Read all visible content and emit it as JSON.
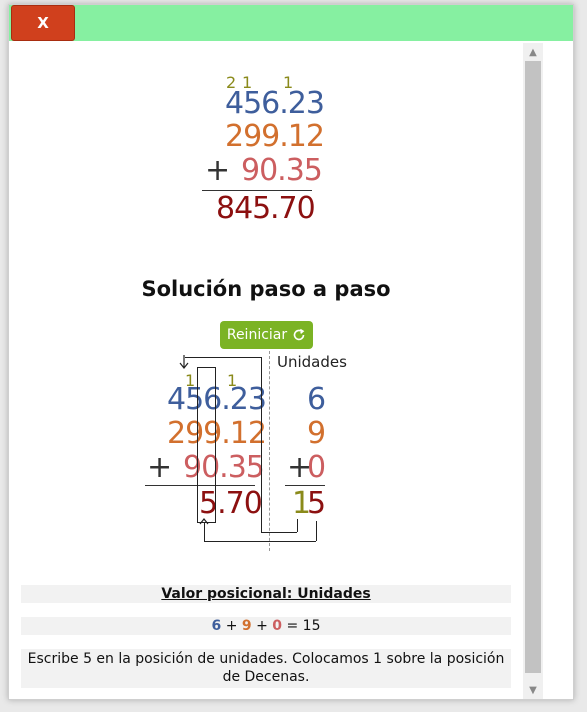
{
  "window": {
    "close_label": "X"
  },
  "top_problem": {
    "carries": [
      "2",
      "1",
      "1"
    ],
    "addends": [
      "456.23",
      "299.12",
      "90.35"
    ],
    "operator": "+",
    "result_int": "845",
    "result_dec": ".70"
  },
  "solution": {
    "heading": "Solución paso a paso",
    "reset_label": "Reiniciar",
    "reset_icon": "refresh-icon",
    "column_label": "Unidades",
    "carries": [
      "1",
      "1"
    ],
    "addends": [
      "456.23",
      "299.12",
      "90.35"
    ],
    "operator": "+",
    "partial_result": "5.70",
    "column_digits": [
      "6",
      "9",
      "0"
    ],
    "column_operator": "+",
    "column_sum_tens": "1",
    "column_sum_units": "5"
  },
  "info": {
    "title": "Valor posicional: Unidades",
    "eq_a": "6",
    "eq_plus1": "+",
    "eq_b": "9",
    "eq_plus2": "+",
    "eq_c": "0",
    "eq_equals": "=",
    "eq_result": "15",
    "description": "Escribe 5 en la posición de unidades. Colocamos 1 sobre la posición de Decenas."
  },
  "colors": {
    "titlebar": "#86f0a1",
    "close": "#d0401d",
    "blue": "#3e5e9c",
    "orange": "#d2702e",
    "rose": "#cc5e60",
    "dark_red": "#8c1010",
    "olive": "#8a8a1a",
    "button_green": "#7bb324"
  }
}
